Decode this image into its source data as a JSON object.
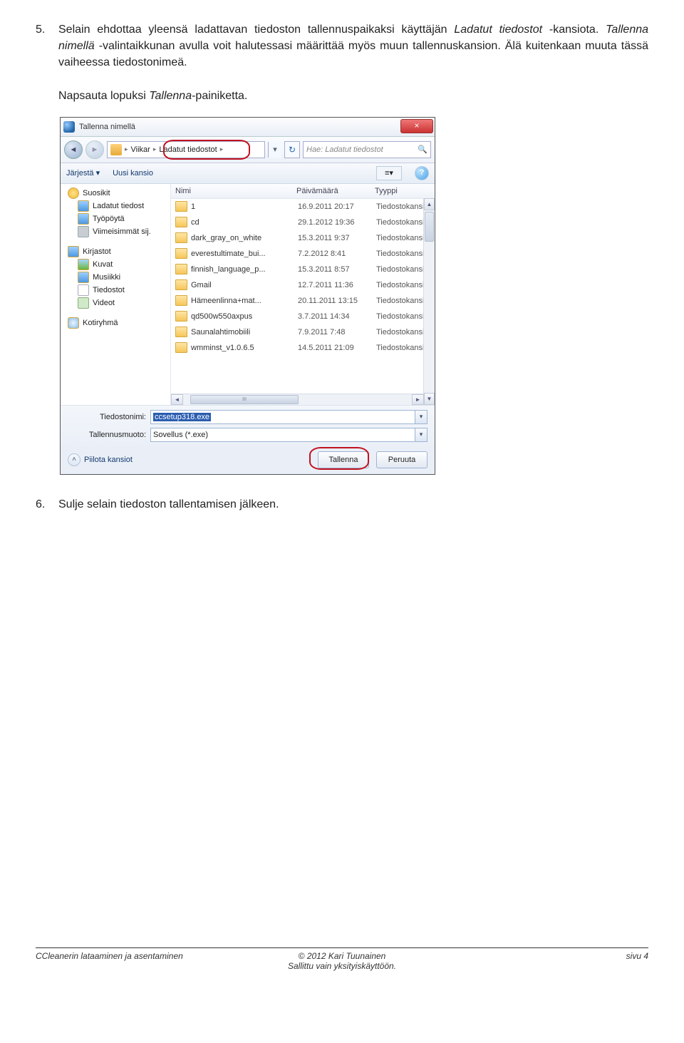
{
  "step5": {
    "num": "5.",
    "text_a": "Selain ehdottaa yleensä ladattavan tiedoston tallennuspaikaksi käyttäjän ",
    "italic_a": "Ladatut tiedostot",
    "text_b": " -kansiota. ",
    "italic_b": "Tallenna nimellä",
    "text_c": " -valintaikkunan avulla voit halutessasi määrittää myös muun tallennuskansion. Älä kuitenkaan muuta tässä vaiheessa tiedostonimeä.",
    "text_d": "Napsauta lopuksi ",
    "italic_c": "Tallenna",
    "text_e": "-painiketta."
  },
  "step6": {
    "num": "6.",
    "text": "Sulje selain tiedoston tallentamisen jälkeen."
  },
  "dialog": {
    "title": "Tallenna nimellä",
    "close": "×",
    "crumb1": "Viikar",
    "crumb2": "Ladatut tiedostot",
    "search_placeholder": "Hae: Ladatut tiedostot",
    "organize": "Järjestä ▾",
    "newfolder": "Uusi kansio",
    "nav": {
      "fav": "Suosikit",
      "fav_items": [
        "Ladatut tiedost",
        "Työpöytä",
        "Viimeisimmät sij."
      ],
      "lib": "Kirjastot",
      "lib_items": [
        "Kuvat",
        "Musiikki",
        "Tiedostot",
        "Videot"
      ],
      "home": "Kotiryhmä"
    },
    "cols": {
      "name": "Nimi",
      "date": "Päivämäärä",
      "type": "Tyyppi"
    },
    "rows": [
      {
        "n": "1",
        "d": "16.9.2011 20:17",
        "t": "Tiedostokansio"
      },
      {
        "n": "cd",
        "d": "29.1.2012 19:36",
        "t": "Tiedostokansio"
      },
      {
        "n": "dark_gray_on_white",
        "d": "15.3.2011 9:37",
        "t": "Tiedostokansio"
      },
      {
        "n": "everestultimate_bui...",
        "d": "7.2.2012 8:41",
        "t": "Tiedostokansio"
      },
      {
        "n": "finnish_language_p...",
        "d": "15.3.2011 8:57",
        "t": "Tiedostokansio"
      },
      {
        "n": "Gmail",
        "d": "12.7.2011 11:36",
        "t": "Tiedostokansio"
      },
      {
        "n": "Hämeenlinna+mat...",
        "d": "20.11.2011 13:15",
        "t": "Tiedostokansio"
      },
      {
        "n": "qd500w550axpus",
        "d": "3.7.2011 14:34",
        "t": "Tiedostokansio"
      },
      {
        "n": "Saunalahtimobiili",
        "d": "7.9.2011 7:48",
        "t": "Tiedostokansio"
      },
      {
        "n": "wmminst_v1.0.6.5",
        "d": "14.5.2011 21:09",
        "t": "Tiedostokansio"
      }
    ],
    "hscroll_marker": "III",
    "filename_label": "Tiedostonimi:",
    "filename_value": "ccsetup318.exe",
    "filetype_label": "Tallennusmuoto:",
    "filetype_value": "Sovellus (*.exe)",
    "hide_folders": "Piilota kansiot",
    "save": "Tallenna",
    "cancel": "Peruuta"
  },
  "footer": {
    "left": "CCleanerin lataaminen ja asentaminen",
    "mid1": "© 2012 Kari Tuunainen",
    "mid2": "Sallittu vain yksityiskäyttöön.",
    "right": "sivu 4"
  }
}
